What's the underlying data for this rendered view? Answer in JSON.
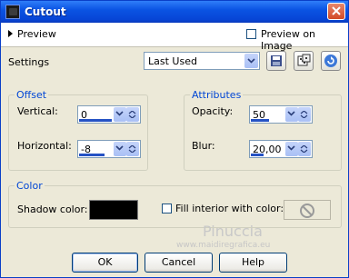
{
  "window": {
    "title": "Cutout"
  },
  "preview": {
    "label": "Preview",
    "preview_on_image_label": "Preview on Image",
    "preview_on_image_checked": false
  },
  "settings": {
    "label": "Settings",
    "value": "Last Used",
    "icons": [
      "save-preset-icon",
      "randomize-icon",
      "reset-icon"
    ]
  },
  "offset": {
    "title": "Offset",
    "vertical_label": "Vertical:",
    "vertical_value": "0",
    "horizontal_label": "Horizontal:",
    "horizontal_value": "-8"
  },
  "attributes": {
    "title": "Attributes",
    "opacity_label": "Opacity:",
    "opacity_value": "50",
    "blur_label": "Blur:",
    "blur_value": "20,00"
  },
  "color": {
    "title": "Color",
    "shadow_label": "Shadow color:",
    "shadow_color": "#000000",
    "fill_interior_label": "Fill interior with color:",
    "fill_interior_checked": false
  },
  "watermark": {
    "line1": "Pinuccia",
    "line2": "www.maidiregrafica.eu"
  },
  "buttons": {
    "ok": "OK",
    "cancel": "Cancel",
    "help": "Help"
  }
}
